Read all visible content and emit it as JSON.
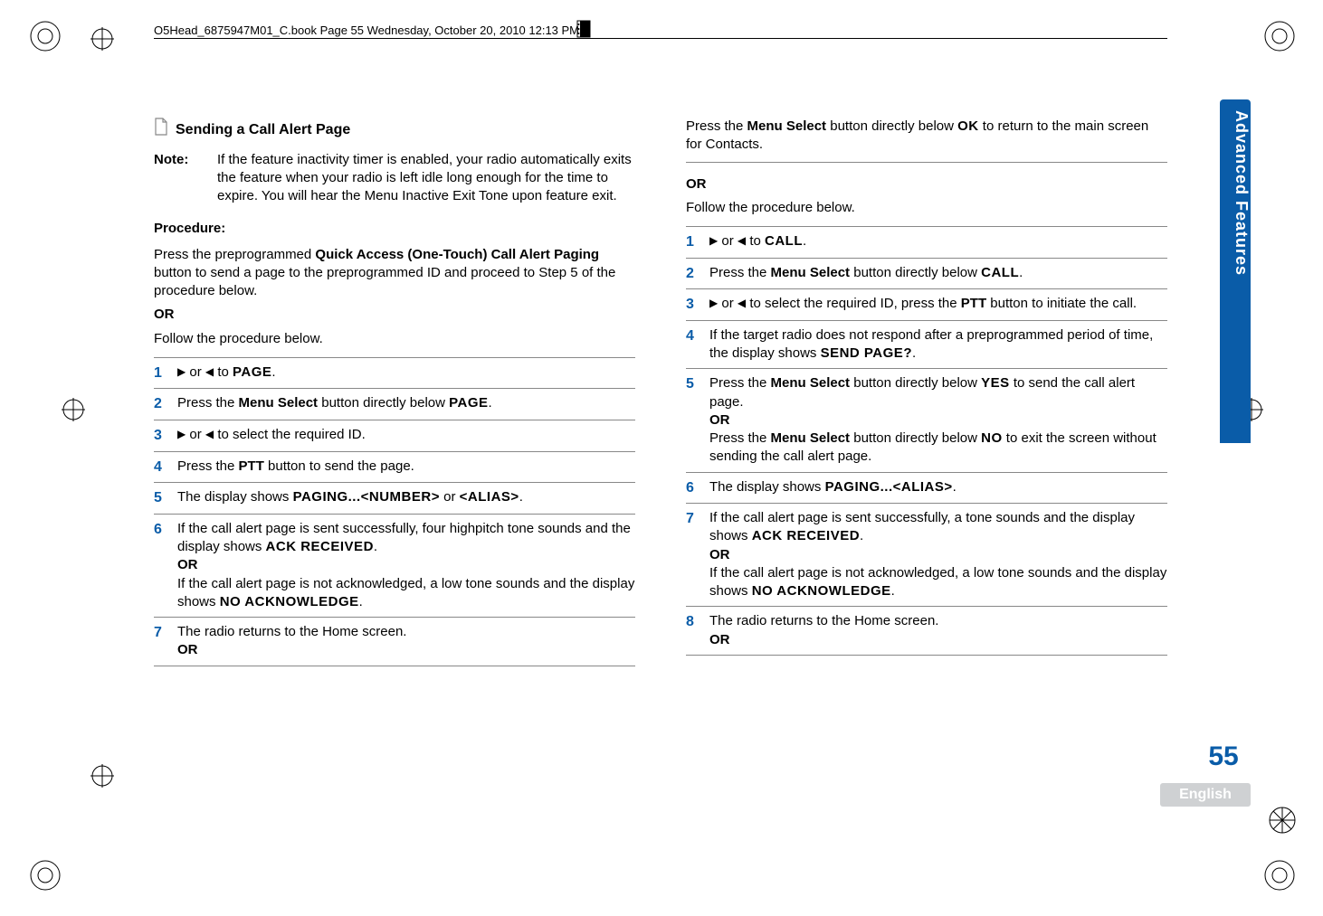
{
  "header": {
    "runhead": "O5Head_6875947M01_C.book  Page 55  Wednesday, October 20, 2010  12:13 PM"
  },
  "sidebar": {
    "title": "Advanced Features",
    "page": "55",
    "lang": "English"
  },
  "left": {
    "section_title": "Sending a Call Alert Page",
    "note_label": "Note:",
    "note_body": "If the feature inactivity timer is enabled, your radio automatically exits the feature when your radio is left idle long enough for the time to expire. You will hear the Menu Inactive Exit Tone upon feature exit.",
    "procedure_label": "Procedure:",
    "intro1a": "Press the preprogrammed ",
    "intro1b": "Quick Access (One-Touch) Call Alert Paging",
    "intro1c": " button to send a page to the preprogrammed ID and proceed to Step 5 of the procedure below.",
    "or": "OR",
    "intro2": "Follow the procedure below.",
    "steps": [
      {
        "n": "1",
        "pre": "",
        "post_a": " or ",
        "post_b": " to ",
        "lcd": "PAGE",
        "tail": "."
      },
      {
        "n": "2",
        "pre": "Press the ",
        "b": "Menu Select",
        "mid": " button directly below ",
        "lcd": "PAGE",
        "tail": "."
      },
      {
        "n": "3",
        "post_a": " or ",
        "post_b": " to select the required ID."
      },
      {
        "n": "4",
        "pre": "Press the ",
        "b": "PTT",
        "mid": " button to send the page."
      },
      {
        "n": "5",
        "pre": "The display shows ",
        "lcd": "PAGING...<NUMBER>",
        "mid2": " or ",
        "lcd2": "<ALIAS>",
        "tail": "."
      },
      {
        "n": "6",
        "l1a": "If the call alert page is sent successfully, four highpitch tone sounds and the display shows ",
        "l1lcd": "ACK RECEIVED",
        "l1tail": ".",
        "or": "OR",
        "l2a": "If the call alert page is not acknowledged, a low tone sounds and the display shows ",
        "l2lcd": "NO ACKNOWLEDGE",
        "l2tail": "."
      },
      {
        "n": "7",
        "pre": "The radio returns to the Home screen.",
        "or": "OR"
      }
    ]
  },
  "right": {
    "cont_a": "Press the ",
    "cont_b": "Menu Select",
    "cont_c": " button directly below ",
    "cont_lcd": "OK",
    "cont_d": " to return to the main screen for Contacts.",
    "or": "OR",
    "intro2": "Follow the procedure below.",
    "steps": [
      {
        "n": "1",
        "post_a": " or ",
        "post_b": " to ",
        "lcd": "CALL",
        "tail": "."
      },
      {
        "n": "2",
        "pre": "Press the ",
        "b": "Menu Select",
        "mid": " button directly below ",
        "lcd": "CALL",
        "tail": "."
      },
      {
        "n": "3",
        "post_a": " or ",
        "post_b": " to select the required ID, press the ",
        "b": "PTT",
        "tail2": " button to initiate the call."
      },
      {
        "n": "4",
        "pre": "If the target radio does not respond after a preprogrammed period of time, the display shows ",
        "lcd": "SEND PAGE?",
        "tail": "."
      },
      {
        "n": "5",
        "l1a": "Press the ",
        "l1b": "Menu Select",
        "l1c": " button directly below ",
        "l1lcd": "YES",
        "l1d": " to send the call alert page.",
        "or": "OR",
        "l2a": "Press the ",
        "l2b": "Menu Select",
        "l2c": " button directly below ",
        "l2lcd": "NO",
        "l2d": " to exit the screen without sending the call alert page."
      },
      {
        "n": "6",
        "pre": "The display shows ",
        "lcd": "PAGING...<ALIAS>",
        "tail": "."
      },
      {
        "n": "7",
        "l1a": "If the call alert page is sent successfully, a tone sounds and the display shows ",
        "l1lcd": "ACK RECEIVED",
        "l1tail": ".",
        "or": "OR",
        "l2a": "If the call alert page is not acknowledged, a low tone sounds and the display shows ",
        "l2lcd": "NO ACKNOWLEDGE",
        "l2tail": "."
      },
      {
        "n": "8",
        "pre": "The radio returns to the Home screen.",
        "or": "OR"
      }
    ]
  }
}
